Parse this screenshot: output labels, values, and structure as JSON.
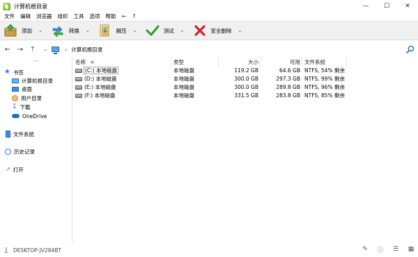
{
  "window": {
    "title": "计算机根目录",
    "controls": [
      "minimize-icon",
      "maximize-icon",
      "close-icon"
    ]
  },
  "menu": {
    "items": [
      "文件",
      "编辑",
      "浏览器",
      "组织",
      "工具",
      "选项",
      "帮助"
    ],
    "nav_back": "←",
    "nav_up": "↑"
  },
  "toolbar": {
    "buttons": [
      {
        "label": "添加",
        "icon": "add-archive-icon"
      },
      {
        "label": "转换",
        "icon": "convert-icon"
      },
      {
        "label": "解压",
        "icon": "extract-icon"
      },
      {
        "label": "测试",
        "icon": "test-check-icon"
      },
      {
        "label": "安全删除",
        "icon": "secure-delete-icon"
      }
    ]
  },
  "address": {
    "breadcrumb": "计算机根目录"
  },
  "nav_pane": {
    "favorites_label": "书签",
    "favorites": [
      "计算机根目录",
      "桌面",
      "用户目录",
      "下载",
      "OneDrive"
    ],
    "filesystem_label": "文件系统",
    "history_label": "历史记录",
    "open_label": "打开"
  },
  "table": {
    "headers": {
      "name": "名称",
      "type": "类型",
      "size": "大小",
      "free": "可用",
      "fs": "文件系统"
    },
    "rows": [
      {
        "name": "(C:) 本地磁盘",
        "type": "本地磁盘",
        "size": "119.2 GB",
        "free": "64.6 GB",
        "fs": "NTFS, 54% 剩余"
      },
      {
        "name": "(D:) 本地磁盘",
        "type": "本地磁盘",
        "size": "300.0 GB",
        "free": "297.3 GB",
        "fs": "NTFS, 99% 剩余"
      },
      {
        "name": "(E:) 本地磁盘",
        "type": "本地磁盘",
        "size": "300.0 GB",
        "free": "289.8 GB",
        "fs": "NTFS, 96% 剩余"
      },
      {
        "name": "(F:) 本地磁盘",
        "type": "本地磁盘",
        "size": "331.5 GB",
        "free": "283.8 GB",
        "fs": "NTFS, 85% 剩余"
      }
    ]
  },
  "status": {
    "computer_name": "DESKTOP-JV284BT"
  },
  "colors": {
    "toolbar_bg": "#f0f0f0",
    "accent_blue": "#1e6fb8",
    "delete_red": "#d0202a",
    "test_green": "#2e9a2e"
  }
}
